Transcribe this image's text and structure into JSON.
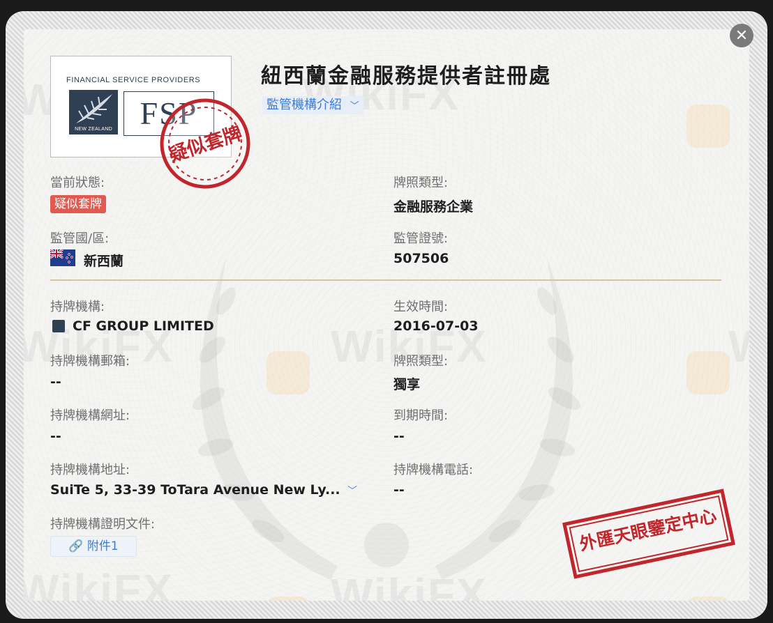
{
  "header": {
    "title": "紐西蘭金融服務提供者註冊處",
    "intro_link": "監管機構介紹"
  },
  "logo": {
    "topline": "FINANCIAL SERVICE PROVIDERS",
    "badge_text": "NEW ZEALAND",
    "mark": "FSP"
  },
  "stamps": {
    "suspect_clone": "疑似套牌",
    "appraisal_center": "外匯天眼鑒定中心"
  },
  "watermark": {
    "brand": "WikiFX"
  },
  "status": {
    "label": "當前狀態:",
    "value": "疑似套牌",
    "color": "#e15a50"
  },
  "license_type_top": {
    "label": "牌照類型:",
    "value": "金融服務企業"
  },
  "region": {
    "label": "監管國/區:",
    "value": "新西蘭",
    "flag_icon": "new-zealand-flag-icon"
  },
  "reg_number": {
    "label": "監管證號:",
    "value": "507506"
  },
  "licensee": {
    "label": "持牌機構:",
    "value": "CF GROUP LIMITED"
  },
  "effective_date": {
    "label": "生效時間:",
    "value": "2016-07-03"
  },
  "licensee_email": {
    "label": "持牌機構郵箱:",
    "value": "--"
  },
  "license_type_bottom": {
    "label": "牌照類型:",
    "value": "獨享"
  },
  "licensee_website": {
    "label": "持牌機構網址:",
    "value": "--"
  },
  "expiry_date": {
    "label": "到期時間:",
    "value": "--"
  },
  "licensee_address": {
    "label": "持牌機構地址:",
    "value": "SuiTe 5, 33-39 ToTara Avenue New Ly..."
  },
  "licensee_phone": {
    "label": "持牌機構電話:",
    "value": "--"
  },
  "documents": {
    "label": "持牌機構證明文件:",
    "attachment": "附件1"
  },
  "colors": {
    "accent_blue": "#3d7bd8",
    "divider_gold": "#d9c49b",
    "stamp_red": "#c0262b"
  }
}
